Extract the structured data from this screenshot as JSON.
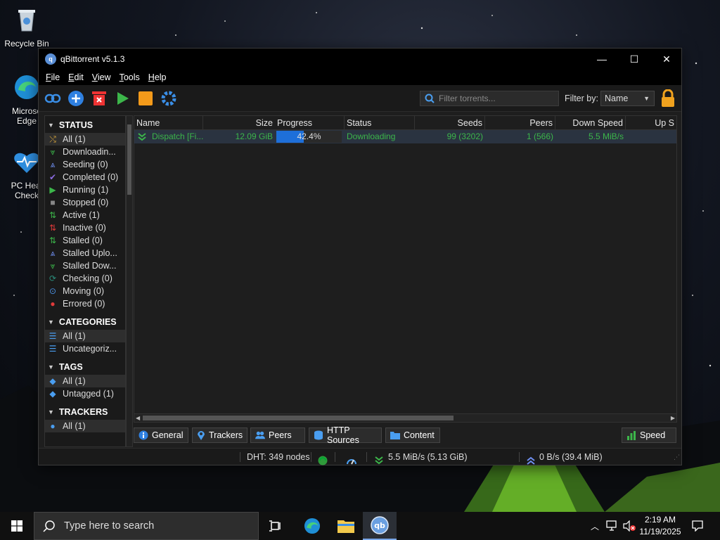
{
  "desktop": {
    "icons": [
      {
        "label": "Recycle Bin"
      },
      {
        "label": "Microsoft Edge",
        "label_visible": "Microso\nEdge"
      },
      {
        "label": "PC Health Check",
        "label_visible": "PC Heal\nCheck"
      }
    ]
  },
  "window": {
    "title": "qBittorrent v5.1.3",
    "controls": {
      "minimize": "—",
      "maximize": "☐",
      "close": "✕"
    }
  },
  "menu": {
    "items": [
      {
        "label": "File",
        "ul": "F",
        "rest": "ile"
      },
      {
        "label": "Edit",
        "ul": "E",
        "rest": "dit"
      },
      {
        "label": "View",
        "ul": "V",
        "rest": "iew"
      },
      {
        "label": "Tools",
        "ul": "T",
        "rest": "ools"
      },
      {
        "label": "Help",
        "ul": "H",
        "rest": "elp"
      }
    ]
  },
  "toolbar": {
    "buttons": [
      "add-link-icon",
      "add-torrent-icon",
      "delete-icon",
      "resume-icon",
      "pause-icon",
      "options-icon"
    ],
    "filter_placeholder": "Filter torrents...",
    "filter_by_label": "Filter by:",
    "filter_by_value": "Name"
  },
  "sidebar": {
    "status": {
      "title": "STATUS",
      "items": [
        {
          "label": "All (1)",
          "icon": "shuffle-icon",
          "color": "#d4a33c"
        },
        {
          "label": "Downloadin...",
          "icon": "download-icon",
          "color": "#3cb64a"
        },
        {
          "label": "Seeding (0)",
          "icon": "upload-icon",
          "color": "#6f8ff0"
        },
        {
          "label": "Completed (0)",
          "icon": "check-icon",
          "color": "#8b6be0"
        },
        {
          "label": "Running (1)",
          "icon": "play-icon",
          "color": "#3cb64a"
        },
        {
          "label": "Stopped (0)",
          "icon": "stop-icon",
          "color": "#888888"
        },
        {
          "label": "Active (1)",
          "icon": "active-icon",
          "color": "#3cb64a"
        },
        {
          "label": "Inactive (0)",
          "icon": "inactive-icon",
          "color": "#e03a3a"
        },
        {
          "label": "Stalled (0)",
          "icon": "stalled-icon",
          "color": "#3cb64a"
        },
        {
          "label": "Stalled Uplo...",
          "icon": "stalled-upload-icon",
          "color": "#6f8ff0"
        },
        {
          "label": "Stalled Dow...",
          "icon": "stalled-download-icon",
          "color": "#3cb64a"
        },
        {
          "label": "Checking (0)",
          "icon": "checking-icon",
          "color": "#2a8c7a"
        },
        {
          "label": "Moving (0)",
          "icon": "moving-icon",
          "color": "#4a8fe0"
        },
        {
          "label": "Errored (0)",
          "icon": "error-icon",
          "color": "#e03a3a"
        }
      ]
    },
    "categories": {
      "title": "CATEGORIES",
      "items": [
        {
          "label": "All (1)",
          "icon": "list-icon"
        },
        {
          "label": "Uncategoriz...",
          "icon": "list-icon"
        }
      ]
    },
    "tags": {
      "title": "TAGS",
      "items": [
        {
          "label": "All (1)",
          "icon": "tag-icon"
        },
        {
          "label": "Untagged (1)",
          "icon": "tag-icon"
        }
      ]
    },
    "trackers": {
      "title": "TRACKERS",
      "items": [
        {
          "label": "All (1)",
          "icon": "pin-icon"
        }
      ]
    }
  },
  "table": {
    "columns": [
      "Name",
      "Size",
      "Progress",
      "Status",
      "Seeds",
      "Peers",
      "Down Speed",
      "Up S"
    ],
    "rows": [
      {
        "name": "Dispatch [Fi...",
        "size": "12.09 GiB",
        "progress_text": "42.4%",
        "progress_value": 0.424,
        "status": "Downloading",
        "seeds": "99 (3202)",
        "peers": "1 (566)",
        "down_speed": "5.5 MiB/s",
        "up_speed": ""
      }
    ]
  },
  "tabs": [
    "General",
    "Trackers",
    "Peers",
    "HTTP Sources",
    "Content",
    "Speed"
  ],
  "statusbar": {
    "dht": "DHT: 349 nodes",
    "down": "5.5 MiB/s (5.13 GiB)",
    "up": "0 B/s (39.4 MiB)"
  },
  "taskbar": {
    "search_placeholder": "Type here to search",
    "time": "2:19 AM",
    "date": "11/19/2025"
  },
  "colors": {
    "accent": "#1e6fd9",
    "download_green": "#3cb64a",
    "selected_row": "#2a3340"
  }
}
